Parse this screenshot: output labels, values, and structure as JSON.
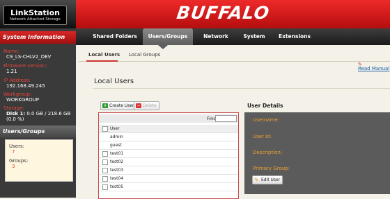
{
  "brand": {
    "product": "LinkStation",
    "tagline": "Network Attached Storage",
    "logo": "BUFFALO"
  },
  "nav": {
    "items": [
      "Shared Folders",
      "Users/Groups",
      "Network",
      "System",
      "Extensions"
    ],
    "active": "Users/Groups"
  },
  "sidebar": {
    "system_info_title": "System Information",
    "name_label": "Name:",
    "name_value": "C9_LS-CHLV2_DEV",
    "fw_label": "Firmware version:",
    "fw_value": "1.21",
    "ip_label": "IP Address:",
    "ip_value": "192.168.49.245",
    "wg_label": "Workgroup:",
    "wg_value": "WORKGROUP",
    "storage_label": "Storage:",
    "storage_disk": "Disk 1:",
    "storage_value": "0.0 GB / 218.6 GB",
    "storage_pct": "(0.0 %)",
    "ug_title": "Users/Groups",
    "users_label": "Users:",
    "users_value": "7",
    "groups_label": "Groups:",
    "groups_value": "3"
  },
  "subtabs": [
    "Local Users",
    "Local Groups"
  ],
  "read_manual": "Read Manual",
  "page_title": "Local Users",
  "toolbar": {
    "create_label": "Create User",
    "delete_label": "Delete"
  },
  "list": {
    "find_label": "Find",
    "column_user": "User",
    "users": [
      "admin",
      "guest",
      "test01",
      "test02",
      "test03",
      "test04",
      "test05"
    ]
  },
  "details": {
    "title": "User Details",
    "username_label": "Username:",
    "userid_label": "User Id:",
    "description_label": "Description:",
    "primary_group_label": "Primary Group:",
    "edit_label": "Edit User"
  },
  "colors": {
    "accent": "#d81e1e",
    "label": "#f0a030"
  }
}
